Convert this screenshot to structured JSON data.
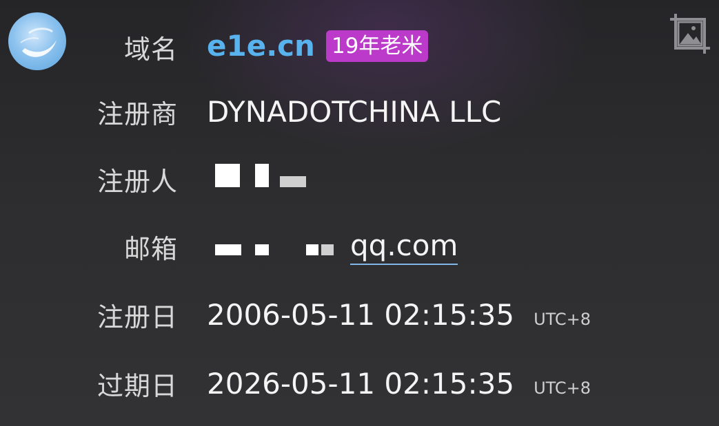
{
  "rows": {
    "domain": {
      "label": "域名",
      "value": "e1e.cn",
      "badge": "19年老米"
    },
    "registrar": {
      "label": "注册商",
      "value": "DYNADOTCHINA LLC"
    },
    "registrant": {
      "label": "注册人"
    },
    "email": {
      "label": "邮箱",
      "value_suffix": "qq.com"
    },
    "registered": {
      "label": "注册日",
      "value": "2006-05-11 02:15:35",
      "tz": "UTC+8"
    },
    "expires": {
      "label": "过期日",
      "value": "2026-05-11 02:15:35",
      "tz": "UTC+8"
    }
  },
  "icons": {
    "avatar": "feather-avatar",
    "image_tool": "image-crop-icon"
  },
  "colors": {
    "domain": "#58b2ee",
    "badge": "#bb3ac9",
    "background": "#2c2c2e"
  }
}
